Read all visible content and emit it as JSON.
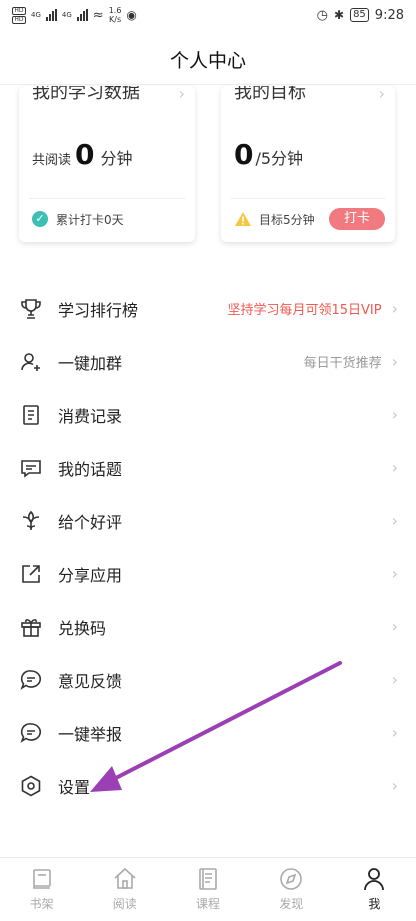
{
  "status_bar": {
    "network": "4G",
    "speed_value": "1.6",
    "speed_unit": "K/s",
    "battery": "85",
    "time": "9:28"
  },
  "header": {
    "title": "个人中心"
  },
  "cards": {
    "learning": {
      "title": "我的学习数据",
      "prefix": "共阅读",
      "value": "0",
      "unit": "分钟",
      "footer": "累计打卡0天"
    },
    "goal": {
      "title": "我的目标",
      "value": "0",
      "unit": "/5分钟",
      "footer": "目标5分钟",
      "button": "打卡"
    }
  },
  "menu": [
    {
      "label": "学习排行榜",
      "extra": "坚持学习每月可领15日VIP",
      "icon": "trophy-icon"
    },
    {
      "label": "一键加群",
      "extra": "每日干货推荐",
      "icon": "add-group-icon"
    },
    {
      "label": "消费记录",
      "icon": "receipt-icon"
    },
    {
      "label": "我的话题",
      "icon": "chat-icon"
    },
    {
      "label": "给个好评",
      "icon": "flower-icon"
    },
    {
      "label": "分享应用",
      "icon": "share-icon"
    },
    {
      "label": "兑换码",
      "icon": "gift-icon"
    },
    {
      "label": "意见反馈",
      "icon": "feedback-icon"
    },
    {
      "label": "一键举报",
      "icon": "report-icon"
    },
    {
      "label": "设置",
      "icon": "settings-icon"
    }
  ],
  "bottom_nav": [
    {
      "label": "书架",
      "icon": "bookshelf-icon"
    },
    {
      "label": "阅读",
      "icon": "home-icon"
    },
    {
      "label": "课程",
      "icon": "course-icon"
    },
    {
      "label": "发现",
      "icon": "discover-icon"
    },
    {
      "label": "我",
      "icon": "profile-icon",
      "active": true
    }
  ],
  "colors": {
    "accent_red": "#f0594f",
    "button_pink": "#f07a7f",
    "check_teal": "#3dbfb3",
    "warn_yellow": "#f5c842",
    "annotation_purple": "#9b3fb5"
  }
}
